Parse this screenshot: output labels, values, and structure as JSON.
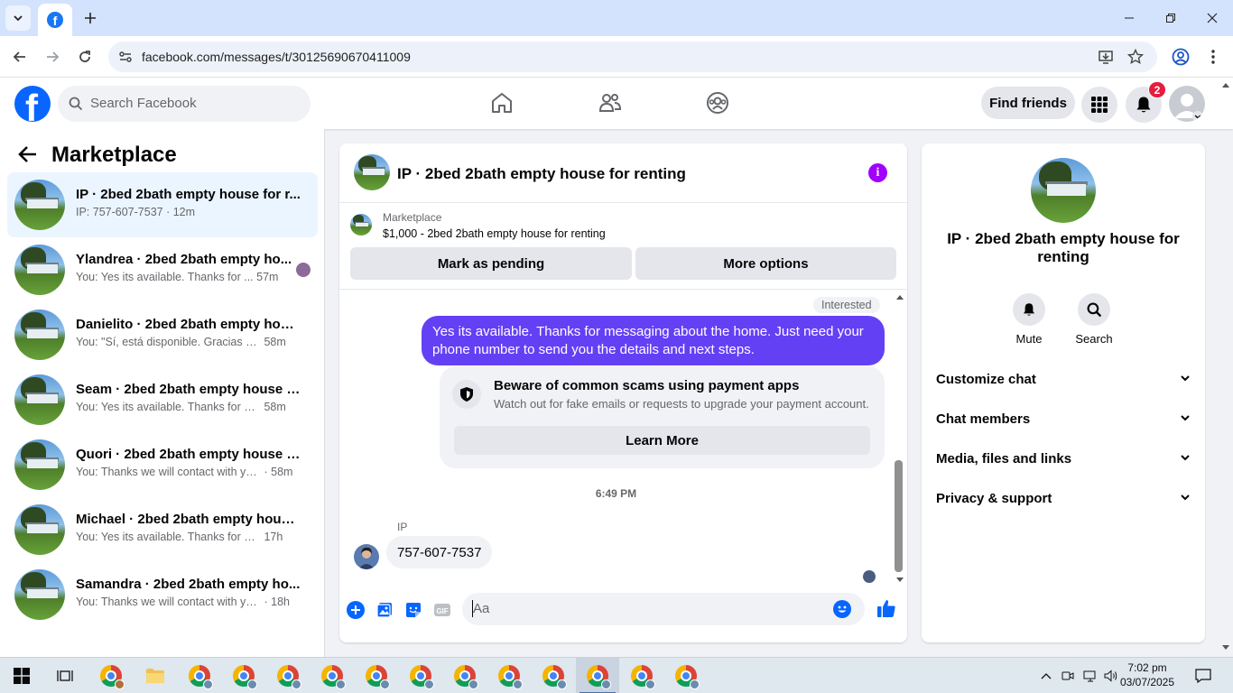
{
  "browser": {
    "url": "facebook.com/messages/t/30125690670411009"
  },
  "header": {
    "search_placeholder": "Search Facebook",
    "find_friends": "Find friends",
    "notif_count": "2"
  },
  "left": {
    "title": "Marketplace",
    "conversations": [
      {
        "name": "IP · 2bed 2bath empty house for r...",
        "snippet": "IP: 757-607-7537",
        "time": "· 12m"
      },
      {
        "name": "Ylandrea · 2bed 2bath empty ho...",
        "snippet": "You: Yes its available. Thanks for ...",
        "time": "57m"
      },
      {
        "name": "Danielito · 2bed 2bath empty hous...",
        "snippet": "You: \"Sí, está disponible. Gracias por...",
        "time": "58m"
      },
      {
        "name": "Seam · 2bed 2bath empty house f...",
        "snippet": "You: Yes its available. Thanks for me...",
        "time": "58m"
      },
      {
        "name": "Quori · 2bed 2bath empty house f...",
        "snippet": "You: Thanks we will contact with yo...",
        "time": "· 58m"
      },
      {
        "name": "Michael · 2bed 2bath empty house...",
        "snippet": "You: Yes its available. Thanks for mes...",
        "time": "17h"
      },
      {
        "name": "Samandra · 2bed 2bath empty ho...",
        "snippet": "You: Thanks we will contact with you...",
        "time": "· 18h"
      }
    ]
  },
  "chat": {
    "title": "IP · 2bed 2bath empty house for renting",
    "marketplace_label": "Marketplace",
    "listing": "$1,000 - 2bed 2bath empty house for renting",
    "mark_pending": "Mark as pending",
    "more_options": "More options",
    "interested": "Interested",
    "outgoing_message": "Yes its available. Thanks for messaging about the home. Just need your phone number to send you the details and next steps.",
    "warning_title": "Beware of common scams using payment apps",
    "warning_desc": "Watch out for fake emails or requests to upgrade your payment account.",
    "learn_more": "Learn More",
    "timestamp": "6:49 PM",
    "sender": "IP",
    "incoming_message": "757-607-7537",
    "composer_placeholder": "Aa"
  },
  "right": {
    "name": "IP · 2bed 2bath empty house for renting",
    "mute": "Mute",
    "search": "Search",
    "sections": [
      "Customize chat",
      "Chat members",
      "Media, files and links",
      "Privacy & support"
    ]
  },
  "taskbar": {
    "time": "7:02 pm",
    "date": "03/07/2025"
  },
  "colors": {
    "fb_blue": "#0866ff",
    "outgoing_bubble": "#6440f5",
    "info_purple": "#a100ff",
    "badge_red": "#e41e3f"
  }
}
